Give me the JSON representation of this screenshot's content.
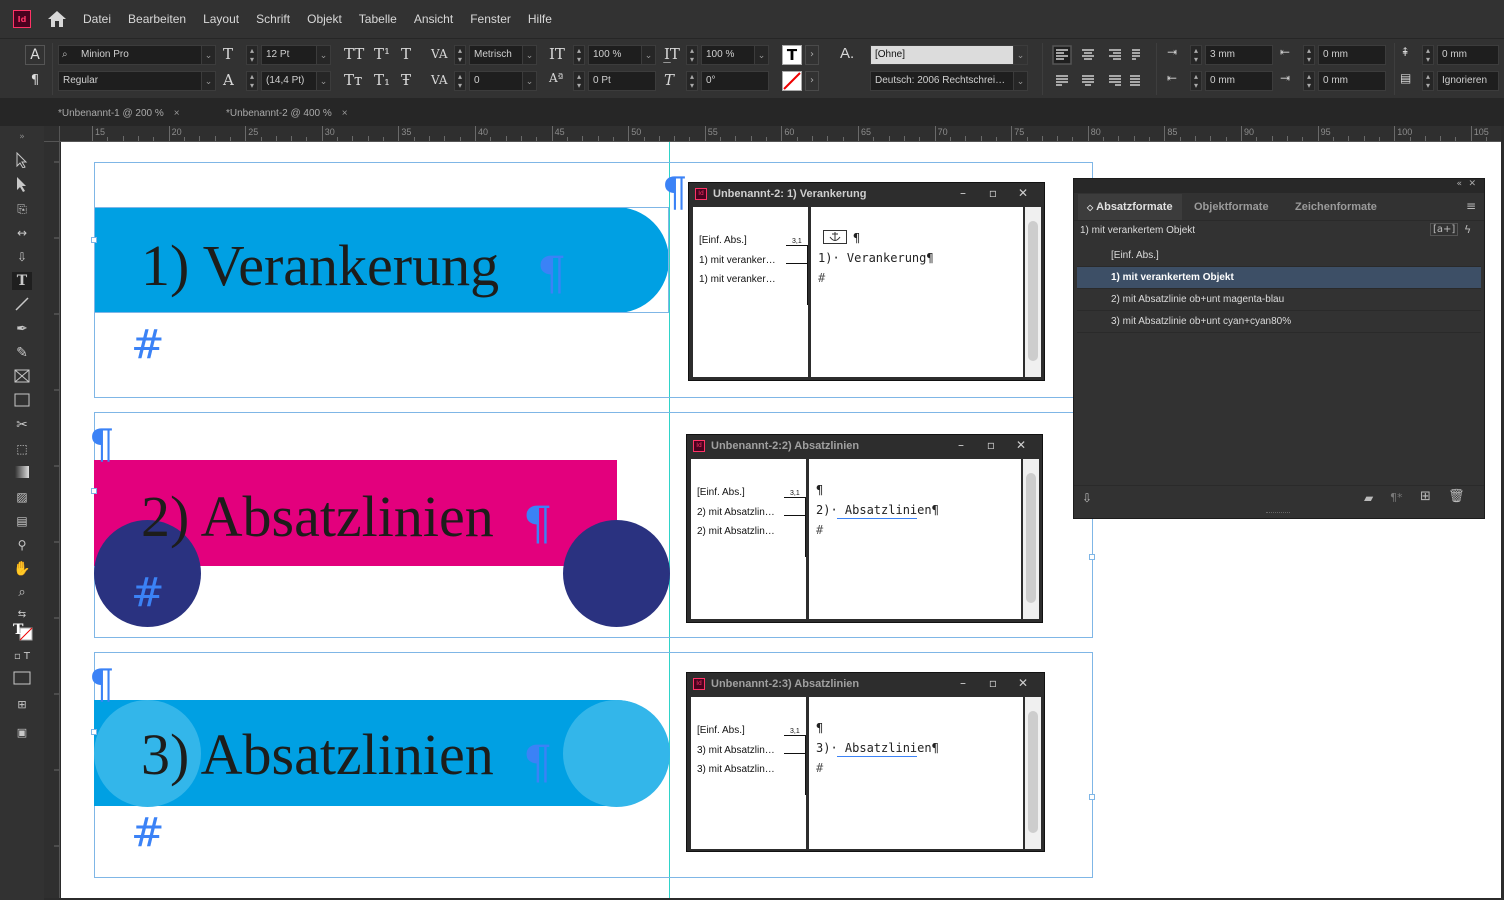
{
  "menubar": {
    "app_logo": "Id",
    "items": [
      "Datei",
      "Bearbeiten",
      "Layout",
      "Schrift",
      "Objekt",
      "Tabelle",
      "Ansicht",
      "Fenster",
      "Hilfe"
    ]
  },
  "control": {
    "font_family": "Minion Pro",
    "font_style": "Regular",
    "font_size": "12 Pt",
    "leading": "(14,4 Pt)",
    "kerning": "Metrisch",
    "tracking": "0",
    "vscale": "100 %",
    "hscale": "100 %",
    "baseline_shift": "0 Pt",
    "skew": "0°",
    "char_style": "[Ohne]",
    "language": "Deutsch: 2006 Rechtschrei…",
    "indent_left": "3 mm",
    "indent_right": "0 mm",
    "first_line": "0 mm",
    "last_line": "0 mm",
    "space_before": "0 mm",
    "space_after": "0 mm",
    "grid_align": "Ignorieren",
    "icons": {
      "char_mode": "A",
      "para_mode": "¶"
    }
  },
  "tabs": [
    {
      "label": "*Unbenannt-1 @ 200 %",
      "close": "×"
    },
    {
      "label": "*Unbenannt-2 @ 400 %",
      "close": "×"
    }
  ],
  "ruler": {
    "marks": [
      "15",
      "20",
      "25",
      "30",
      "35",
      "40",
      "45",
      "50",
      "55",
      "60",
      "65",
      "70",
      "75",
      "80",
      "85",
      "90",
      "95",
      "100",
      "105"
    ]
  },
  "canvas": {
    "heading1": "1) Verankerung",
    "heading2": "2) Absatzlinien",
    "heading3": "3) Absatzlinien",
    "pilcrow": "¶",
    "hash": "#",
    "colors": {
      "cyan": "#00a0e3",
      "magenta": "#e3007d",
      "navy": "#2a3280",
      "cyan80": "#33b6ea",
      "guide": "#7fb6e6",
      "hidden_char": "#3b82f6"
    }
  },
  "story_editors": [
    {
      "title": "Unbenannt-2: 1) Verankerung",
      "styles": [
        "[Einf. Abs.]",
        "1) mit veranker…",
        "1) mit veranker…"
      ],
      "depth": "3,1",
      "lines": [
        "¶",
        "1)· Verankerung¶",
        "#"
      ]
    },
    {
      "title": "Unbenannt-2:2) Absatzlinien",
      "styles": [
        "[Einf. Abs.]",
        "2) mit Absatzlin…",
        "2) mit Absatzlin…"
      ],
      "depth": "3,1",
      "lines": [
        "¶",
        "2)· Absatzlinien¶",
        "#"
      ]
    },
    {
      "title": "Unbenannt-2:3) Absatzlinien",
      "styles": [
        "[Einf. Abs.]",
        "3) mit Absatzlin…",
        "3) mit Absatzlin…"
      ],
      "depth": "3,1",
      "lines": [
        "¶",
        "3)· Absatzlinien¶",
        "#"
      ]
    }
  ],
  "styles_panel": {
    "tabs": [
      "Absatzformate",
      "Objektformate",
      "Zeichenformate"
    ],
    "current": "1) mit verankertem Objekt",
    "items": [
      "[Einf. Abs.]",
      "1) mit verankertem Objekt",
      "2) mit Absatzlinie ob+unt magenta-blau",
      "3) mit Absatzlinie ob+unt cyan+cyan80%"
    ],
    "selected_index": 1,
    "new_style_btn": "[a+]"
  }
}
